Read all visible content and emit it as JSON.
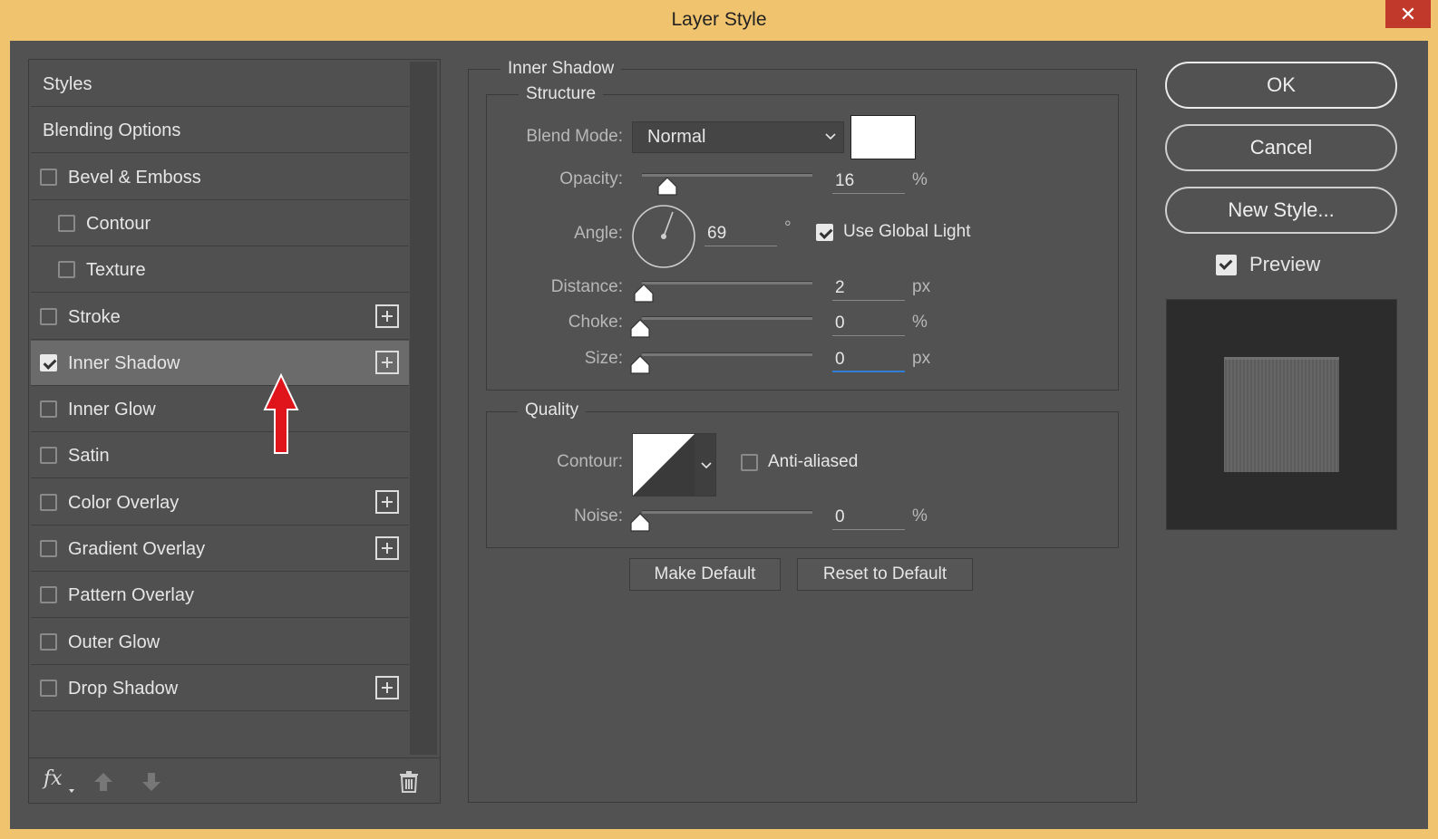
{
  "window": {
    "title": "Layer Style",
    "close_glyph": "✕"
  },
  "styles_panel": {
    "items": [
      {
        "label": "Styles",
        "checkbox": null,
        "checked": false,
        "indent": 0,
        "plus": false,
        "selected": false
      },
      {
        "label": "Blending Options",
        "checkbox": null,
        "checked": false,
        "indent": 0,
        "plus": false,
        "selected": false
      },
      {
        "label": "Bevel & Emboss",
        "checkbox": true,
        "checked": false,
        "indent": 0,
        "plus": false,
        "selected": false
      },
      {
        "label": "Contour",
        "checkbox": true,
        "checked": false,
        "indent": 1,
        "plus": false,
        "selected": false
      },
      {
        "label": "Texture",
        "checkbox": true,
        "checked": false,
        "indent": 1,
        "plus": false,
        "selected": false
      },
      {
        "label": "Stroke",
        "checkbox": true,
        "checked": false,
        "indent": 0,
        "plus": true,
        "selected": false
      },
      {
        "label": "Inner Shadow",
        "checkbox": true,
        "checked": true,
        "indent": 0,
        "plus": true,
        "selected": true
      },
      {
        "label": "Inner Glow",
        "checkbox": true,
        "checked": false,
        "indent": 0,
        "plus": false,
        "selected": false
      },
      {
        "label": "Satin",
        "checkbox": true,
        "checked": false,
        "indent": 0,
        "plus": false,
        "selected": false
      },
      {
        "label": "Color Overlay",
        "checkbox": true,
        "checked": false,
        "indent": 0,
        "plus": true,
        "selected": false
      },
      {
        "label": "Gradient Overlay",
        "checkbox": true,
        "checked": false,
        "indent": 0,
        "plus": true,
        "selected": false
      },
      {
        "label": "Pattern Overlay",
        "checkbox": true,
        "checked": false,
        "indent": 0,
        "plus": false,
        "selected": false
      },
      {
        "label": "Outer Glow",
        "checkbox": true,
        "checked": false,
        "indent": 0,
        "plus": false,
        "selected": false
      },
      {
        "label": "Drop Shadow",
        "checkbox": true,
        "checked": false,
        "indent": 0,
        "plus": true,
        "selected": false
      }
    ],
    "footer": {
      "fx_label": "fx"
    }
  },
  "inner_shadow": {
    "title": "Inner Shadow",
    "structure": {
      "title": "Structure",
      "blend_mode_label": "Blend Mode:",
      "blend_mode_value": "Normal",
      "shadow_color": "#ffffff",
      "opacity_label": "Opacity:",
      "opacity_value": "16",
      "opacity_unit": "%",
      "angle_label": "Angle:",
      "angle_value": "69",
      "angle_unit": "°",
      "use_global_light_label": "Use Global Light",
      "use_global_light_checked": true,
      "distance_label": "Distance:",
      "distance_value": "2",
      "distance_unit": "px",
      "choke_label": "Choke:",
      "choke_value": "0",
      "choke_unit": "%",
      "size_label": "Size:",
      "size_value": "0",
      "size_unit": "px"
    },
    "quality": {
      "title": "Quality",
      "contour_label": "Contour:",
      "anti_aliased_label": "Anti-aliased",
      "anti_aliased_checked": false,
      "noise_label": "Noise:",
      "noise_value": "0",
      "noise_unit": "%"
    },
    "make_default_label": "Make Default",
    "reset_default_label": "Reset to Default"
  },
  "actions": {
    "ok_label": "OK",
    "cancel_label": "Cancel",
    "new_style_label": "New Style...",
    "preview_label": "Preview",
    "preview_checked": true
  },
  "colors": {
    "titlebar": "#f0c46e",
    "panel_bg": "#525252",
    "selected_row": "#6b6b6b",
    "active_field": "#2f7fd6",
    "annotation_arrow": "#e0141b"
  }
}
